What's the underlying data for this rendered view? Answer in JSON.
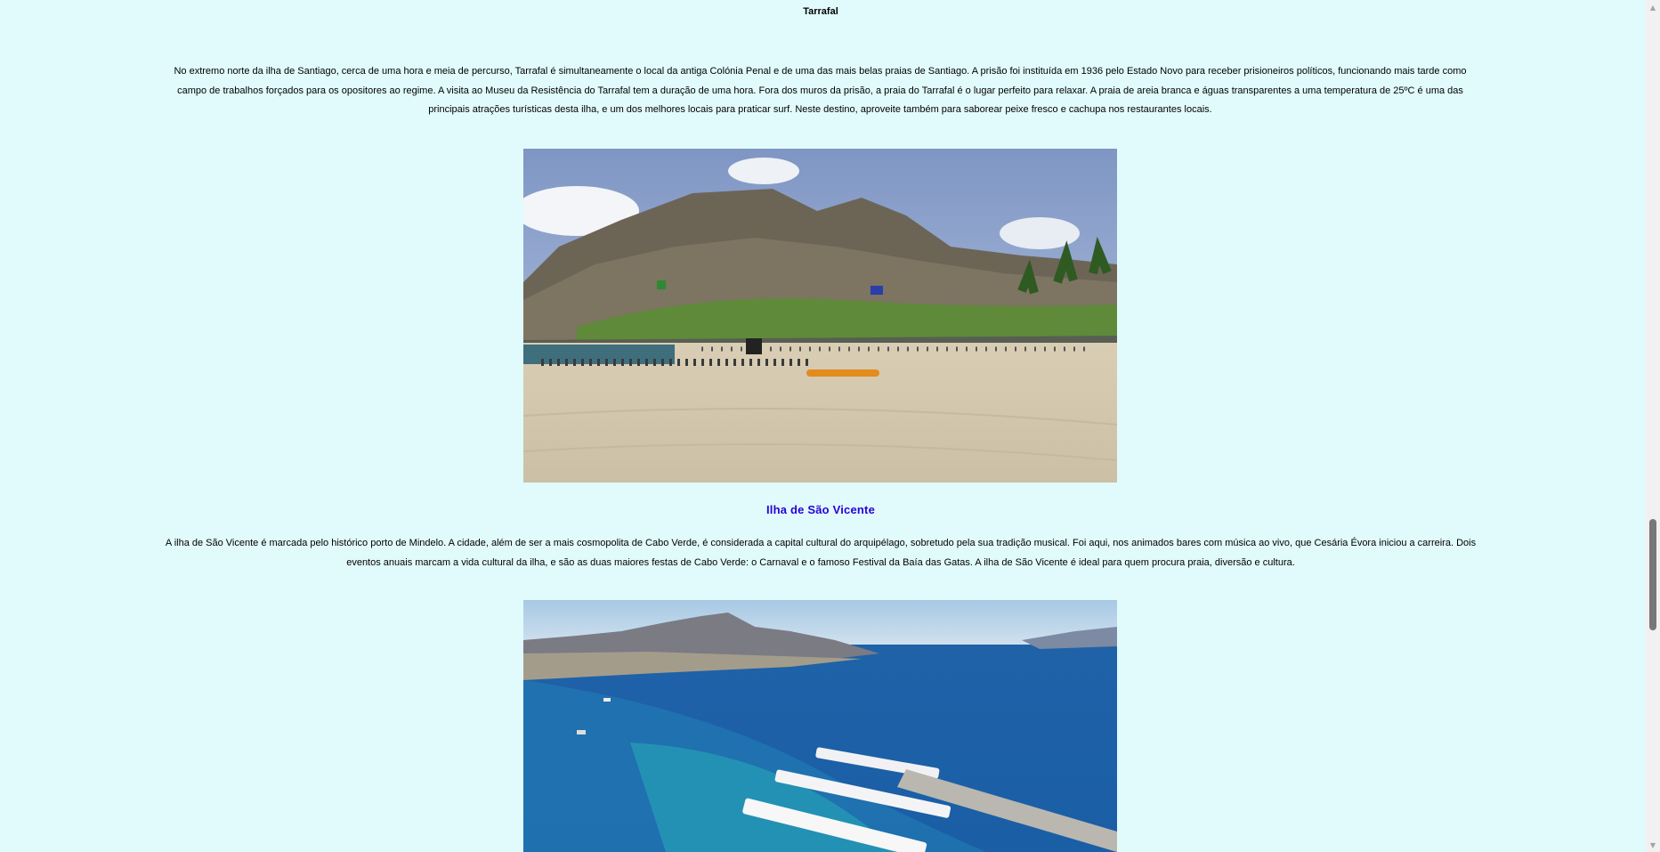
{
  "sections": {
    "tarrafal": {
      "title": "Tarrafal",
      "paragraph": "No extremo norte da ilha de Santiago, cerca de uma hora e meia de percurso, Tarrafal é simultaneamente o local da antiga Colónia Penal e de uma das mais belas praias de Santiago. A prisão foi instituída em 1936 pelo Estado Novo para receber prisioneiros políticos, funcionando mais tarde como campo de trabalhos forçados para os opositores ao regime. A visita ao Museu da Resistência do Tarrafal tem a duração de uma hora. Fora dos muros da prisão, a praia do Tarrafal é o lugar perfeito para relaxar. A praia de areia branca e águas transparentes a uma temperatura de 25ºC é uma das principais atrações turísticas desta ilha, e um dos melhores locais para praticar surf. Neste destino, aproveite também para saborear peixe fresco e cachupa nos restaurantes locais."
    },
    "sao_vicente": {
      "title": "Ilha de São Vicente",
      "paragraph": "A ilha de São Vicente é marcada pelo histórico porto de Mindelo. A cidade, além de ser a mais cosmopolita de Cabo Verde, é considerada a capital cultural do arquipélago, sobretudo pela sua tradição musical. Foi aqui, nos animados bares com música ao vivo, que Cesária Évora iniciou a carreira. Dois eventos anuais marcam a vida cultural da ilha, e são as duas maiores festas de Cabo Verde: o Carnaval e o famoso Festival da Baía das Gatas. A ilha de São Vicente é ideal para quem procura praia, diversão e cultura."
    }
  },
  "scrollbar": {
    "up_icon": "▲",
    "down_icon": "▼"
  },
  "colors": {
    "background": "#e1fbfc",
    "section_title": "#2700d6",
    "text": "#000000"
  }
}
